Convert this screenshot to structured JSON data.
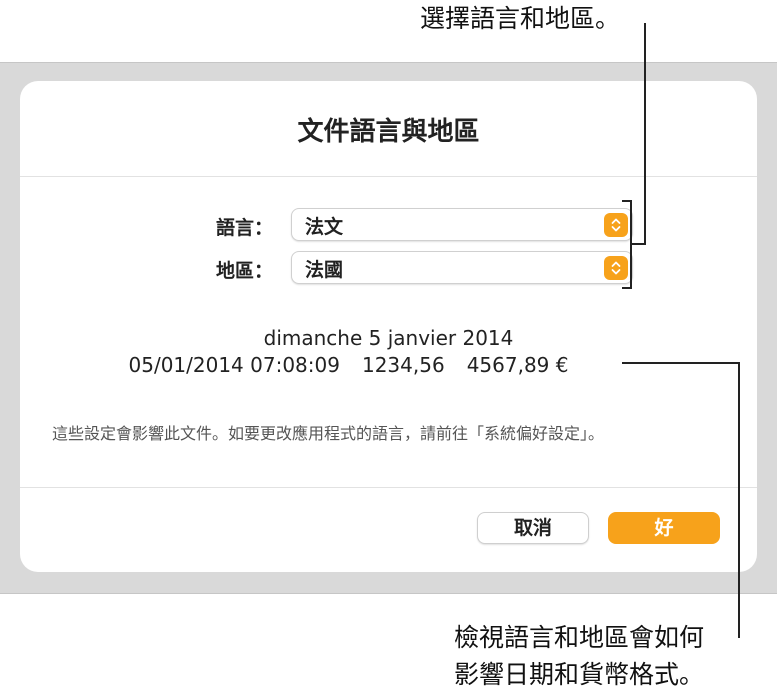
{
  "callouts": {
    "top": "選擇語言和地區。",
    "bottom_line1": "檢視語言和地區會如何",
    "bottom_line2": "影響日期和貨幣格式。"
  },
  "dialog": {
    "title": "文件語言與地區",
    "language_label": "語言：",
    "language_value": "法文",
    "region_label": "地區：",
    "region_value": "法國",
    "sample_date": "dimanche 5 janvier 2014",
    "sample_datetime": "05/01/2014 07:08:09",
    "sample_number": "1234,56",
    "sample_currency": "4567,89 €",
    "note": "這些設定會影響此文件。如要更改應用程式的語言，請前往「系統偏好設定」。",
    "cancel_label": "取消",
    "ok_label": "好"
  },
  "colors": {
    "accent": "#f7a21b",
    "backdrop": "#d9d9d9"
  },
  "icons": {
    "stepper": "chevron-up-down-icon"
  }
}
